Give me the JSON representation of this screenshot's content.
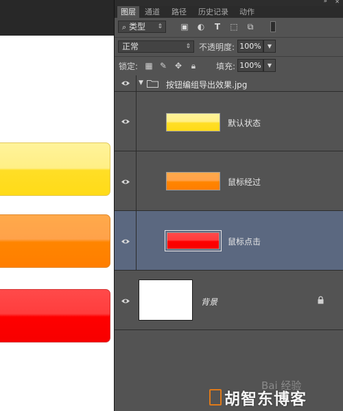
{
  "panel": {
    "tabs": [
      {
        "label": "图层",
        "active": true
      },
      {
        "label": "通道",
        "active": false
      },
      {
        "label": "路径",
        "active": false
      },
      {
        "label": "历史记录",
        "active": false
      },
      {
        "label": "动作",
        "active": false
      }
    ],
    "filter": {
      "icon": "search-icon",
      "label": "类型",
      "filter_icons": [
        "image-icon",
        "adjustment-icon",
        "text-icon",
        "shape-icon",
        "smart-object-icon",
        "toggle-switch-icon"
      ]
    },
    "blend": {
      "mode": "正常",
      "opacity_label": "不透明度:",
      "opacity_value": "100%"
    },
    "lock": {
      "label": "锁定:",
      "icons": [
        "lock-transparent-icon",
        "lock-paint-icon",
        "lock-position-icon",
        "lock-all-icon"
      ],
      "fill_label": "填充:",
      "fill_value": "100%"
    }
  },
  "layers": {
    "group": {
      "name": "按钮编组导出效果.jpg",
      "expanded": true
    },
    "items": [
      {
        "name": "默认状态",
        "thumb_color": "#ffde26",
        "selected": false
      },
      {
        "name": "鼠标经过",
        "thumb_color": "#ff8500",
        "selected": false
      },
      {
        "name": "鼠标点击",
        "thumb_color": "#ff0000",
        "selected": true
      }
    ],
    "background": {
      "name": "背景",
      "locked": true
    }
  },
  "canvas": {
    "buttons": [
      {
        "state": "default",
        "color": "#ffde26"
      },
      {
        "state": "hover",
        "color": "#ff8500"
      },
      {
        "state": "click",
        "color": "#ff0000"
      }
    ]
  },
  "watermark": {
    "baidu_text": "Bai 经验",
    "site_text": "胡智东博客"
  },
  "colors": {
    "panel_bg": "#535353",
    "selected_layer": "#5b6880",
    "tab_bg": "#2b2b2b"
  }
}
